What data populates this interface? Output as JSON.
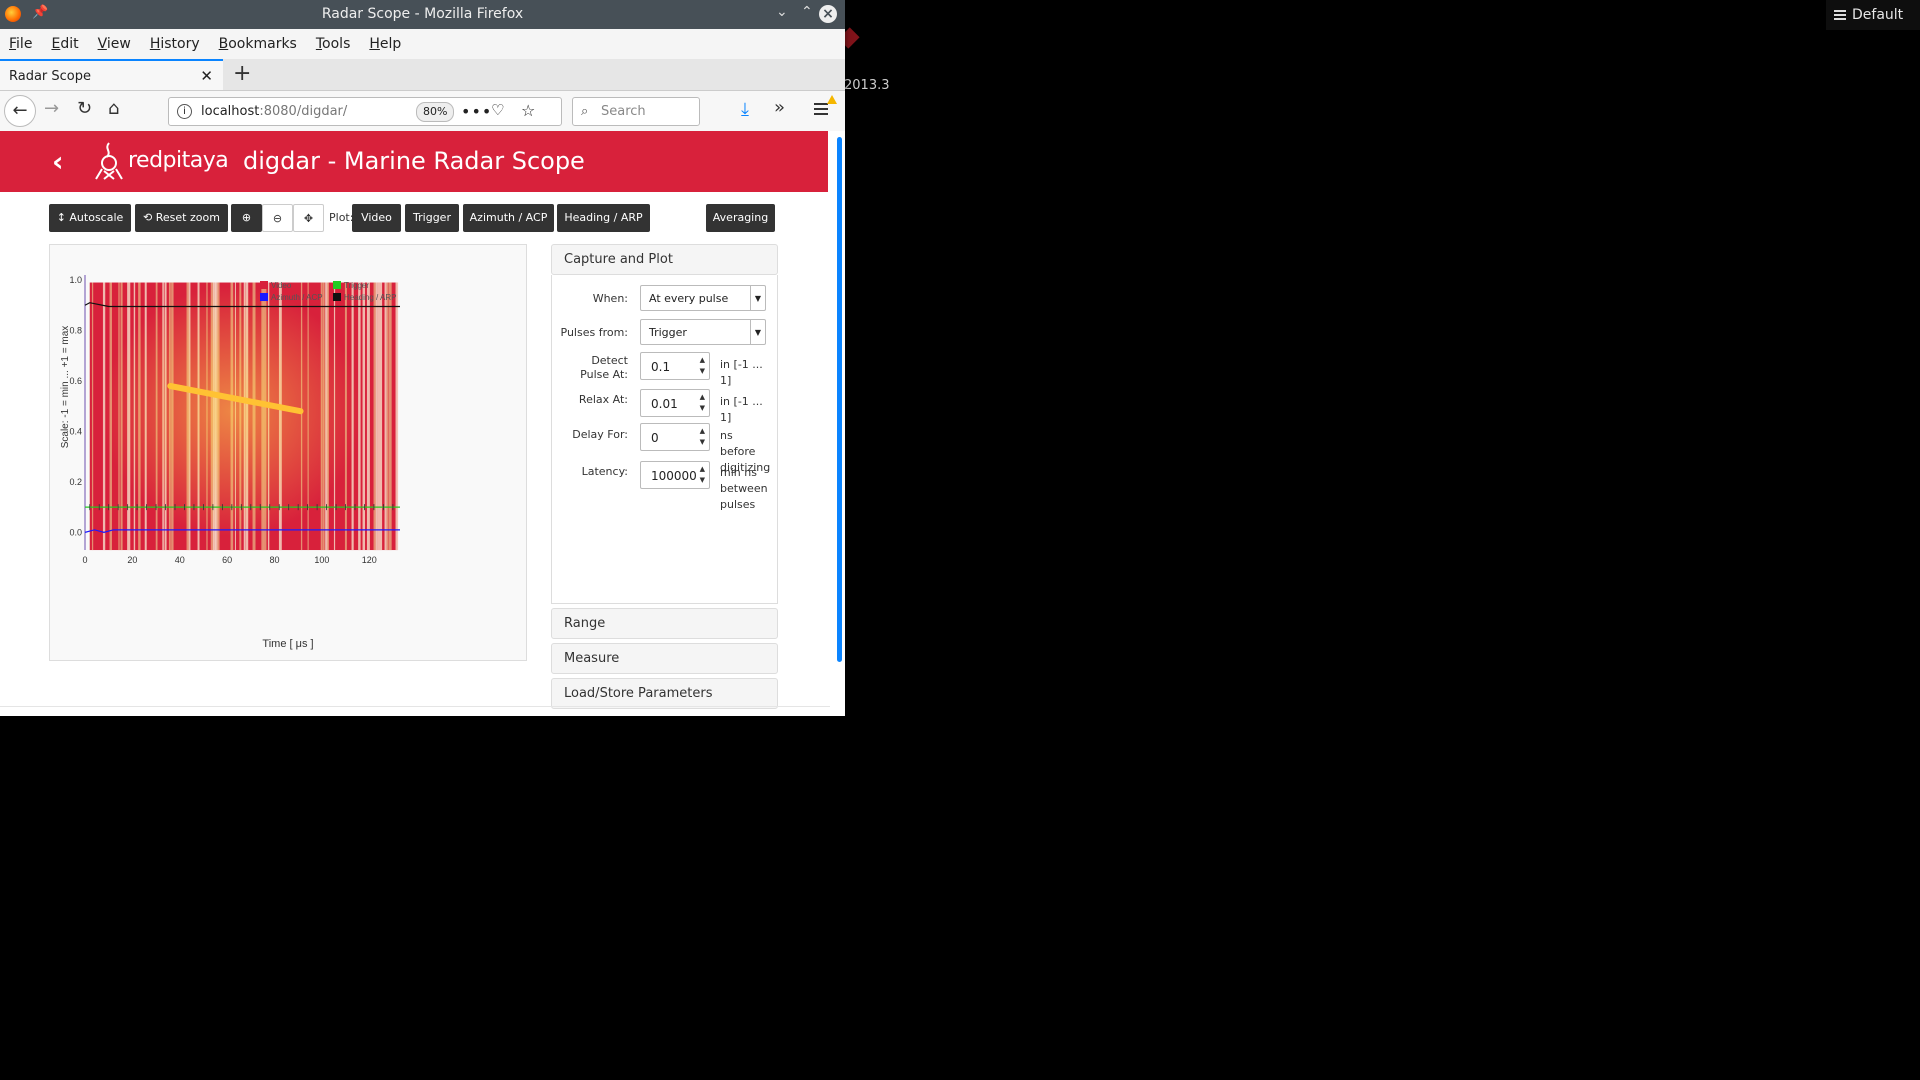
{
  "desktop": {
    "badge_label": "Default",
    "side_text": "2013.3"
  },
  "window": {
    "title": "Radar Scope - Mozilla Firefox"
  },
  "menu": [
    "File",
    "Edit",
    "View",
    "History",
    "Bookmarks",
    "Tools",
    "Help"
  ],
  "tab": {
    "label": "Radar Scope"
  },
  "nav": {
    "url_host": "localhost",
    "url_rest": ":8080/digdar/",
    "zoom": "80%",
    "search_placeholder": "Search"
  },
  "app": {
    "logo_text": "redpitaya",
    "title": "digdar - Marine Radar Scope"
  },
  "toolbar": {
    "autoscale": "Autoscale",
    "reset_zoom": "Reset zoom",
    "plot_label": "Plot:",
    "video": "Video",
    "trigger": "Trigger",
    "azimuth": "Azimuth / ACP",
    "heading": "Heading / ARP",
    "averaging": "Averaging"
  },
  "chart_data": {
    "type": "line",
    "xlabel": "Time [ μs ]",
    "ylabel": "Scale: -1 = min ... +1 = max",
    "xlim": [
      0,
      133
    ],
    "ylim": [
      -0.05,
      1.0
    ],
    "x_ticks": [
      0,
      20,
      40,
      60,
      80,
      100,
      120
    ],
    "y_ticks": [
      "0.0",
      "0.2",
      "0.4",
      "0.6",
      "0.8",
      "1.0"
    ],
    "legend": [
      "Video",
      "Trigger",
      "Azimuth / ACP",
      "Heading / ARP"
    ],
    "series_colors": [
      "#d8213b",
      "#22cc22",
      "#1a1aff",
      "#111111"
    ],
    "series": [
      {
        "name": "Heading / ARP",
        "x": [
          0,
          2,
          10,
          133
        ],
        "y": [
          0.9,
          0.91,
          0.895,
          0.895
        ]
      },
      {
        "name": "Trigger",
        "x": [
          0,
          2,
          133
        ],
        "y": [
          0.1,
          0.1,
          0.1
        ]
      },
      {
        "name": "Azimuth / ACP",
        "x": [
          0,
          4,
          8,
          12,
          133
        ],
        "y": [
          0.0,
          0.01,
          0.0,
          0.01,
          0.01
        ]
      }
    ],
    "video_band": {
      "x_start": 2,
      "x_end": 132,
      "y_low": -0.07,
      "y_high": 0.99
    },
    "highlight": {
      "x": [
        36,
        91
      ],
      "y": [
        0.58,
        0.48
      ],
      "color": "#ffc233"
    }
  },
  "capture": {
    "title": "Capture and Plot",
    "when_label": "When:",
    "when_value": "At every pulse",
    "pulses_label": "Pulses from:",
    "pulses_value": "Trigger",
    "detect_label": "Detect Pulse At:",
    "detect_value": "0.1",
    "detect_unit": "in [-1 ... 1]",
    "relax_label": "Relax At:",
    "relax_value": "0.01",
    "relax_unit": "in [-1 ... 1]",
    "delay_label": "Delay For:",
    "delay_value": "0",
    "delay_unit": "ns before digitizing",
    "latency_label": "Latency:",
    "latency_value": "100000",
    "latency_unit": "min ns between pulses"
  },
  "sections": {
    "range": "Range",
    "measure": "Measure",
    "load_store": "Load/Store Parameters"
  }
}
